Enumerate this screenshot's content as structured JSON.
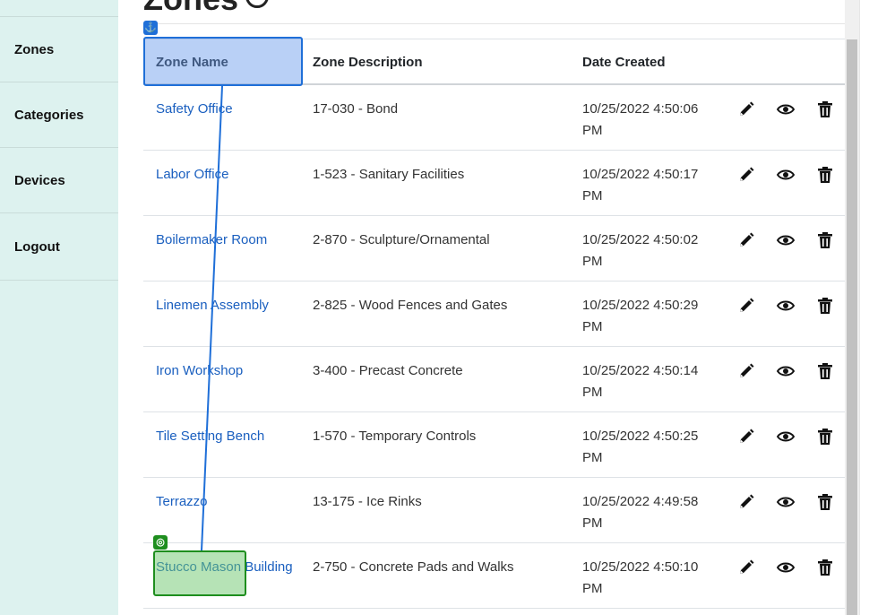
{
  "sidebar": {
    "items": [
      {
        "label": "Zones"
      },
      {
        "label": "Categories"
      },
      {
        "label": "Devices"
      },
      {
        "label": "Logout"
      }
    ]
  },
  "page": {
    "title": "Zones"
  },
  "table": {
    "headers": [
      "Zone Name",
      "Zone Description",
      "Date Created"
    ],
    "rows": [
      {
        "name": "Safety Office",
        "description": "17-030 - Bond",
        "date": "10/25/2022 4:50:06",
        "ampm": "PM"
      },
      {
        "name": "Labor Office",
        "description": "1-523 - Sanitary Facilities",
        "date": "10/25/2022 4:50:17",
        "ampm": "PM"
      },
      {
        "name": "Boilermaker Room",
        "description": "2-870 - Sculpture/Ornamental",
        "date": "10/25/2022 4:50:02",
        "ampm": "PM"
      },
      {
        "name": "Linemen Assembly",
        "description": "2-825 - Wood Fences and Gates",
        "date": "10/25/2022 4:50:29",
        "ampm": "PM"
      },
      {
        "name": "Iron Workshop",
        "description": "3-400 - Precast Concrete",
        "date": "10/25/2022 4:50:14",
        "ampm": "PM"
      },
      {
        "name": "Tile Setting Bench",
        "description": "1-570 - Temporary Controls",
        "date": "10/25/2022 4:50:25",
        "ampm": "PM"
      },
      {
        "name": "Terrazzo",
        "description": "13-175 - Ice Rinks",
        "date": "10/25/2022 4:49:58",
        "ampm": "PM"
      },
      {
        "name": "Stucco Mason Building",
        "description": "2-750 - Concrete Pads and Walks",
        "date": "10/25/2022 4:50:10",
        "ampm": "PM"
      }
    ],
    "actions": {
      "edit_icon": "pencil-icon",
      "view_icon": "eye-icon",
      "delete_icon": "trash-icon"
    }
  },
  "annotation": {
    "source_icon": "anchor-icon",
    "target_icon": "target-icon",
    "source_color": "#1f6fd8",
    "target_color": "#1e8e1e"
  },
  "colors": {
    "sidebar_bg": "#ddf2ef",
    "link": "#1a5fbf"
  }
}
